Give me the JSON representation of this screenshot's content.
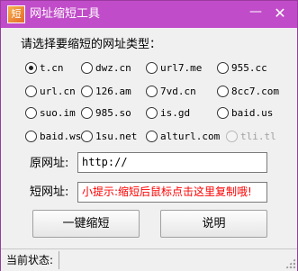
{
  "window": {
    "title": "网址缩短工具",
    "icon_glyph": "短",
    "minimize_glyph": "—",
    "close_glyph": "✕",
    "title_bar_color": "#c14cc9"
  },
  "prompt": "请选择要缩短的网址类型：",
  "radio_options": [
    {
      "label": "t.cn",
      "checked": true,
      "enabled": true
    },
    {
      "label": "dwz.cn",
      "checked": false,
      "enabled": true
    },
    {
      "label": "url7.me",
      "checked": false,
      "enabled": true
    },
    {
      "label": "955.cc",
      "checked": false,
      "enabled": true
    },
    {
      "label": "url.cn",
      "checked": false,
      "enabled": true
    },
    {
      "label": "126.am",
      "checked": false,
      "enabled": true
    },
    {
      "label": "7vd.cn",
      "checked": false,
      "enabled": true
    },
    {
      "label": "8cc7.com",
      "checked": false,
      "enabled": true
    },
    {
      "label": "suo.im",
      "checked": false,
      "enabled": true
    },
    {
      "label": "985.so",
      "checked": false,
      "enabled": true
    },
    {
      "label": "is.gd",
      "checked": false,
      "enabled": true
    },
    {
      "label": "baid.us",
      "checked": false,
      "enabled": true
    },
    {
      "label": "baid.ws",
      "checked": false,
      "enabled": true
    },
    {
      "label": "1su.net",
      "checked": false,
      "enabled": true
    },
    {
      "label": "alturl.com",
      "checked": false,
      "enabled": true
    },
    {
      "label": "tli.tl",
      "checked": false,
      "enabled": false
    }
  ],
  "original_url": {
    "label": "原网址:",
    "value": "http://"
  },
  "short_url": {
    "label": "短网址:",
    "value": "小提示:缩短后鼠标点击这里复制哦!",
    "text_color": "#ff0000"
  },
  "buttons": {
    "shorten": "一键缩短",
    "help": "说明"
  },
  "status": {
    "label": "当前状态:",
    "value": ""
  }
}
